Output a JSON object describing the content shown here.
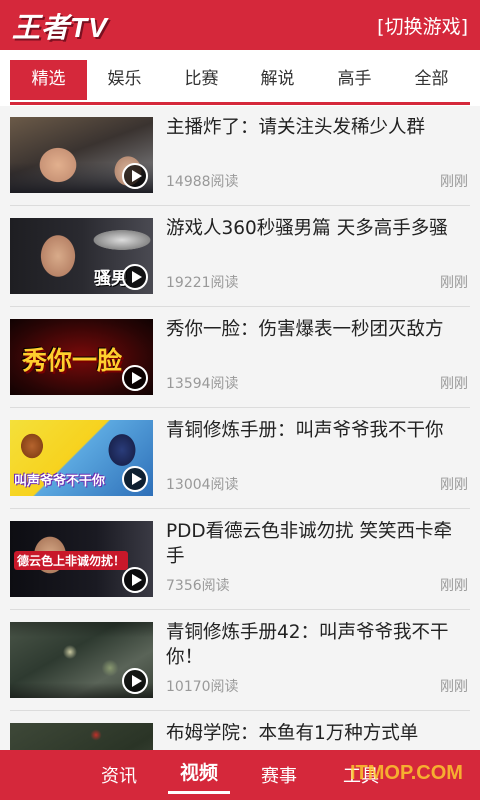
{
  "header": {
    "logo": "王者TV",
    "switch_label": "[切换游戏]"
  },
  "tabs": [
    {
      "label": "精选",
      "active": true
    },
    {
      "label": "娱乐",
      "active": false
    },
    {
      "label": "比赛",
      "active": false
    },
    {
      "label": "解说",
      "active": false
    },
    {
      "label": "高手",
      "active": false
    },
    {
      "label": "全部",
      "active": false
    }
  ],
  "videos": [
    {
      "title": "主播炸了：请关注头发稀少人群",
      "reads": "14988阅读",
      "time": "刚刚",
      "thumb_text": ""
    },
    {
      "title": "游戏人360秒骚男篇 天多高手多骚",
      "reads": "19221阅读",
      "time": "刚刚",
      "thumb_text": "骚男"
    },
    {
      "title": "秀你一脸：伤害爆表一秒团灭敌方",
      "reads": "13594阅读",
      "time": "刚刚",
      "thumb_text": "秀你一脸"
    },
    {
      "title": "青铜修炼手册：叫声爷爷我不干你",
      "reads": "13004阅读",
      "time": "刚刚",
      "thumb_text": "叫声爷爷不干你"
    },
    {
      "title": "PDD看德云色非诚勿扰 笑笑西卡牵手",
      "reads": "7356阅读",
      "time": "刚刚",
      "thumb_text": "德云色上非诚勿扰！"
    },
    {
      "title": "青铜修炼手册42：叫声爷爷我不干你！",
      "reads": "10170阅读",
      "time": "刚刚",
      "thumb_text": ""
    },
    {
      "title": "布姆学院：本鱼有1万种方式单",
      "reads": "",
      "time": "",
      "thumb_text": ""
    }
  ],
  "bottom_nav": [
    {
      "label": "资讯",
      "active": false
    },
    {
      "label": "视频",
      "active": true
    },
    {
      "label": "赛事",
      "active": false
    },
    {
      "label": "工具",
      "active": false
    }
  ],
  "watermark": "ITMOP.COM",
  "colors": {
    "accent": "#d5283b",
    "text": "#222222",
    "muted": "#999999"
  }
}
